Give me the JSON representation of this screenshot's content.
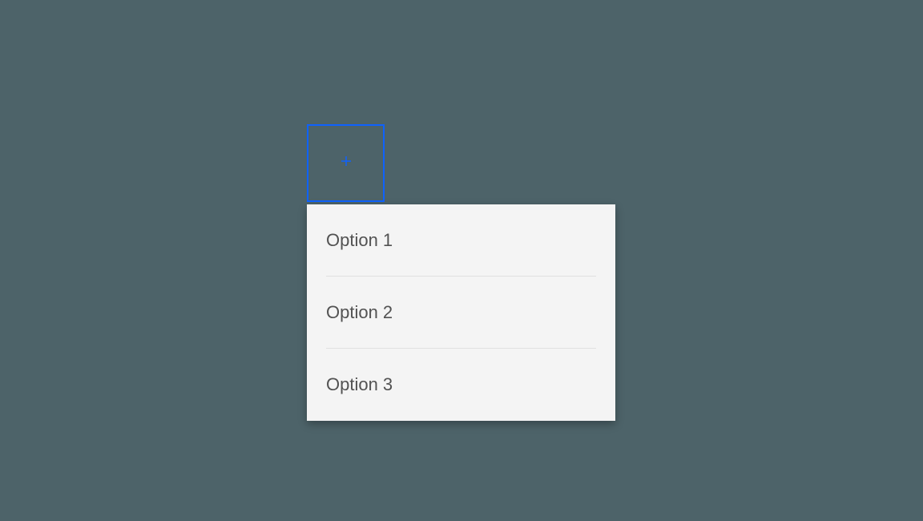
{
  "trigger": {
    "icon": "plus-icon"
  },
  "menu": {
    "options": [
      {
        "label": "Option 1"
      },
      {
        "label": "Option 2"
      },
      {
        "label": "Option 3"
      }
    ]
  },
  "colors": {
    "accent": "#0f62fe",
    "panel": "#f4f4f4",
    "text": "#525252",
    "background": "#4d6369"
  }
}
